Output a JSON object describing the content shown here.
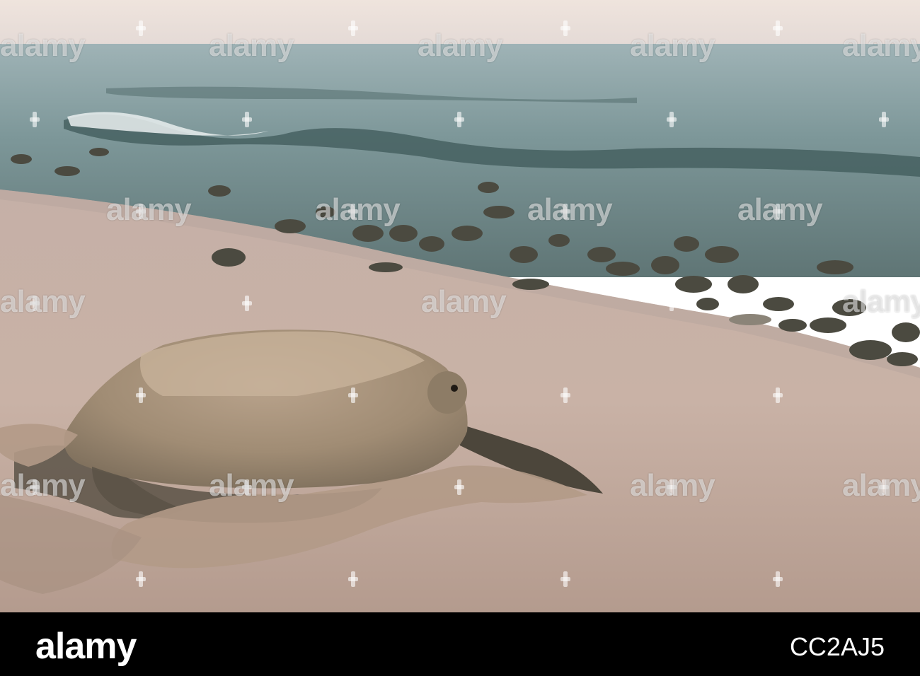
{
  "watermark": {
    "text": "alamy",
    "color": "#ffffff"
  },
  "footer": {
    "logo": "alamy",
    "image_id": "CC2AJ5",
    "background": "#000000",
    "text_color": "#ffffff"
  }
}
